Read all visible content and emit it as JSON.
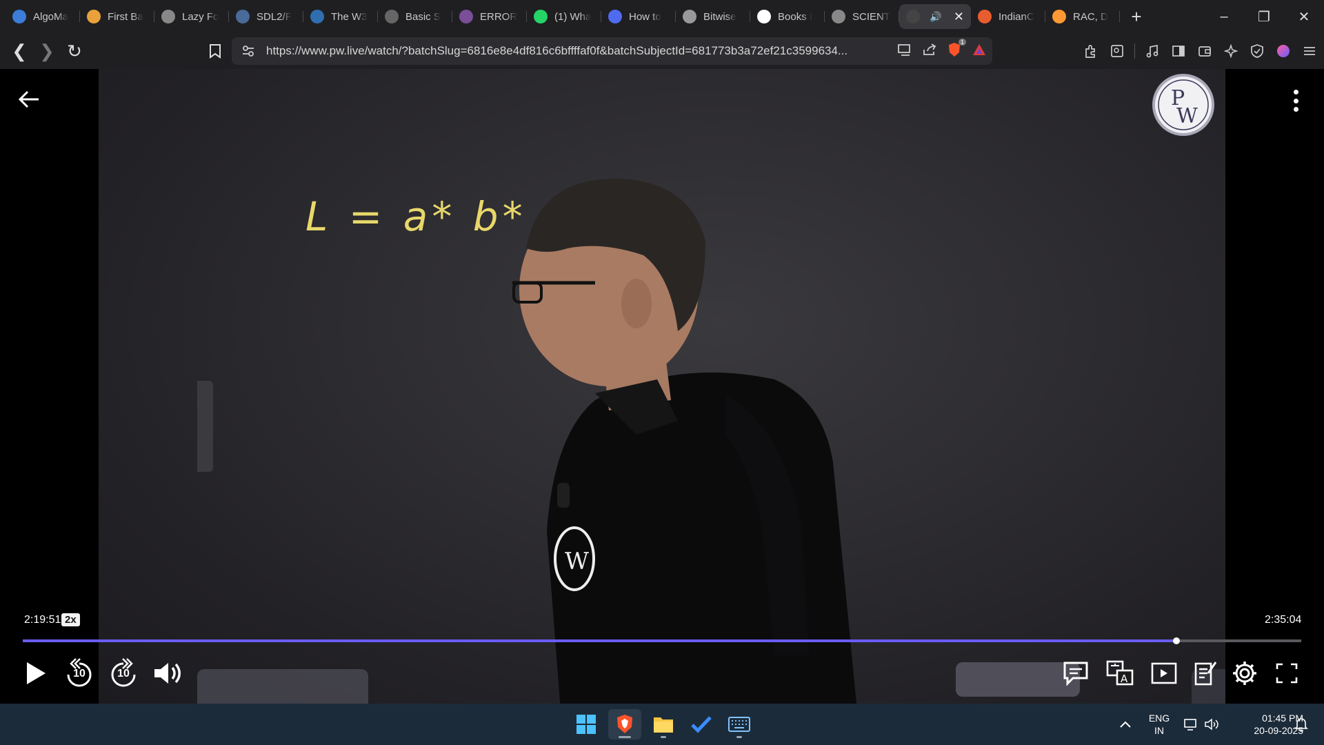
{
  "browser": {
    "tabs": [
      {
        "title": "AlgoMa",
        "icon": "algomaster-icon",
        "color": "#3b7dd8"
      },
      {
        "title": "First Ba",
        "icon": "first-bad-icon",
        "color": "#e9a23b"
      },
      {
        "title": "Lazy Fo",
        "icon": "lazy-foo-icon",
        "color": "#888888"
      },
      {
        "title": "SDL2/F",
        "icon": "sdl-icon",
        "color": "#4a6b9a"
      },
      {
        "title": "The W3",
        "icon": "wordpress-icon",
        "color": "#2f6fb0"
      },
      {
        "title": "Basic S",
        "icon": "basic-icon",
        "color": "#666666"
      },
      {
        "title": "ERROR",
        "icon": "error-icon",
        "color": "#7a4e99"
      },
      {
        "title": "(1) Wha",
        "icon": "whatsapp-icon",
        "color": "#25d366"
      },
      {
        "title": "How to",
        "icon": "howto-icon",
        "color": "#4f6bf0"
      },
      {
        "title": "Bitwise",
        "icon": "bitwise-icon",
        "color": "#999999"
      },
      {
        "title": "Books I",
        "icon": "google-icon",
        "color": "#ffffff"
      },
      {
        "title": "SCIENT",
        "icon": "science-icon",
        "color": "#888888"
      },
      {
        "title": "",
        "icon": "pw-tab-icon",
        "color": "#444444",
        "active": true
      },
      {
        "title": "IndianC",
        "icon": "indian-icon",
        "color": "#e85d2f"
      },
      {
        "title": "RAC, D",
        "icon": "india-flag-icon",
        "color": "#ff9933"
      }
    ],
    "address": {
      "url": "https://www.pw.live/watch/?batchSlug=6816e8e4df816c6bffffaf0f&batchSubjectId=681773b3a72ef21c3599634..."
    },
    "shields_count": "1"
  },
  "video": {
    "board_formula": "L = a* b*",
    "current_time": "2:19:51",
    "speed": "2x",
    "total_time": "2:35:04",
    "progress_fraction": 0.9026,
    "skip_back_label": "10",
    "skip_forward_label": "10"
  },
  "taskbar": {
    "lang_line1": "ENG",
    "lang_line2": "IN",
    "time": "01:45 PM",
    "date": "20-09-2025"
  }
}
